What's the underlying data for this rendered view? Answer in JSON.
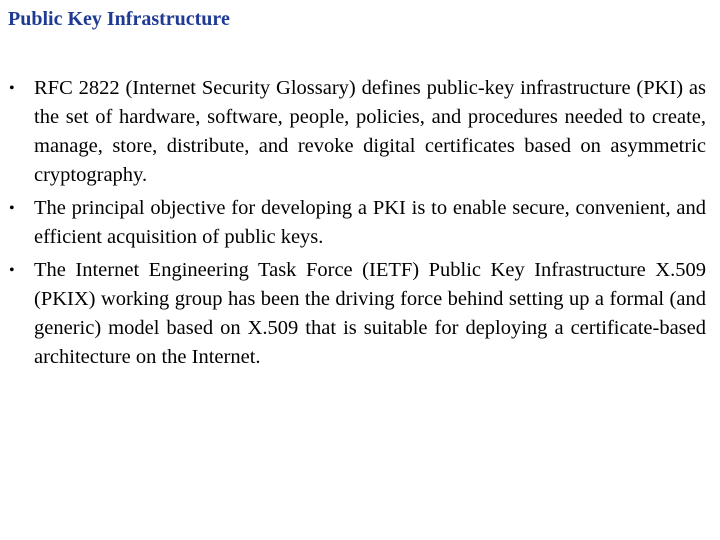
{
  "slide": {
    "title": "Public Key Infrastructure",
    "title_color": "#1F3A93",
    "bullet_icon": "•",
    "bullets": [
      {
        "text": "RFC 2822 (Internet Security Glossary) defines public-key infrastructure (PKI) as the set of hardware, software, people, policies, and procedures needed to create, manage, store, distribute, and revoke digital certificates based on asymmetric cryptography."
      },
      {
        "text": "The principal objective for developing a PKI is to enable secure, convenient, and efficient acquisition of public keys."
      },
      {
        "text": "The Internet Engineering Task Force (IETF) Public Key Infrastructure X.509 (PKIX) working group has been the driving force behind setting up a formal (and generic) model based on X.509 that is suitable for deploying a certificate-based architecture on the Internet."
      }
    ]
  }
}
